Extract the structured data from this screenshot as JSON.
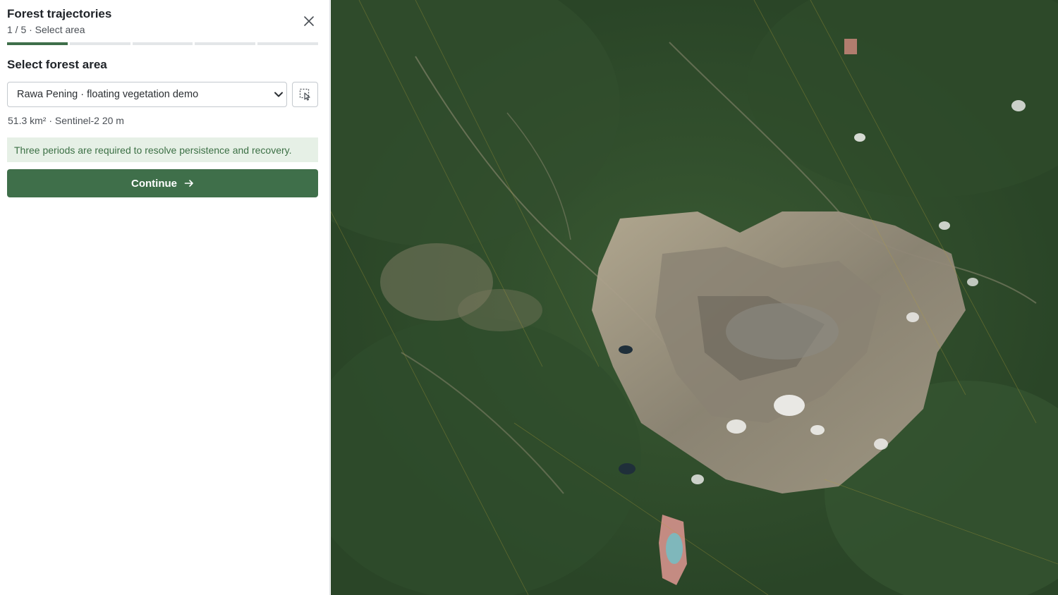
{
  "header": {
    "title": "Forest trajectories",
    "step_text": "1 / 5 · Select area",
    "close_icon": "close-icon"
  },
  "progress": {
    "total_steps": 5,
    "current_step": 1
  },
  "area": {
    "section_title": "Select forest area",
    "selected": "Rawa Pening · floating vegetation demo",
    "meta": "51.3 km² · Sentinel-2 20 m",
    "draw_icon": "select-area-cursor-icon"
  },
  "notice": {
    "text": "Three periods are required to resolve persistence and recovery."
  },
  "actions": {
    "continue_label": "Continue",
    "continue_icon": "arrow-right-icon"
  },
  "colors": {
    "accent": "#3f6f4a",
    "notice_bg": "#e6f0e6",
    "notice_text": "#3c7045"
  }
}
